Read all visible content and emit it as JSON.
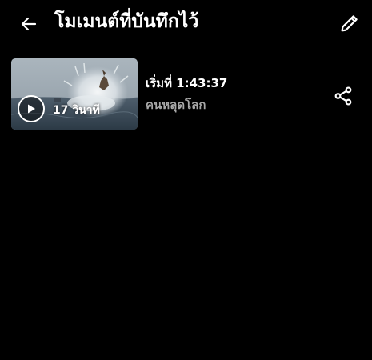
{
  "header": {
    "title": "โมเมนต์ที่บันทึกไว้",
    "back_icon": "arrow-left-icon",
    "edit_icon": "pencil-icon"
  },
  "moments": [
    {
      "duration": "17 วินาที",
      "start_time": "เริ่มที่ 1:43:37",
      "movie_title": "คนหลุดโลก",
      "thumbnail_icon": "play-icon",
      "share_icon": "share-icon"
    }
  ],
  "colors": {
    "background": "#000000",
    "primary_text": "#ffffff",
    "secondary_text": "#a8a8a8"
  }
}
